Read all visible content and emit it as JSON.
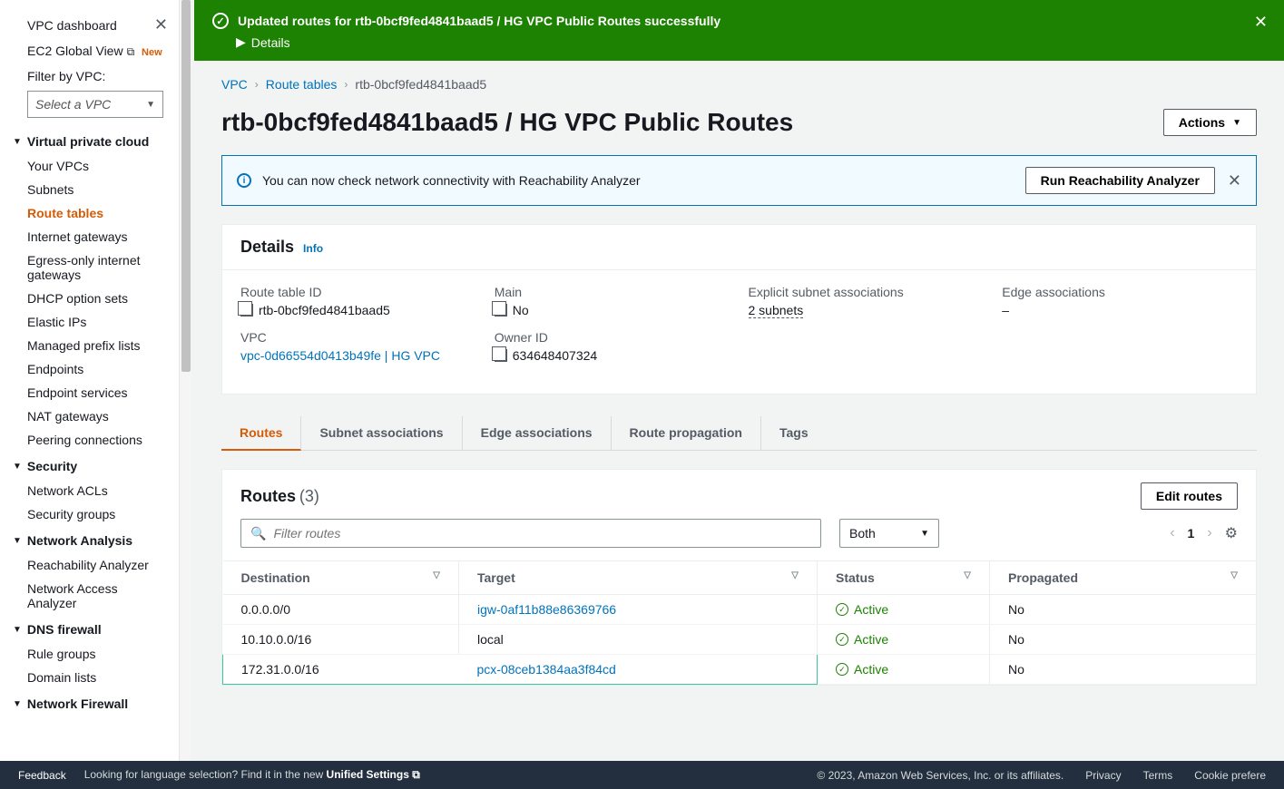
{
  "sidebar": {
    "top": {
      "dashboard": "VPC dashboard",
      "global_view": "EC2 Global View",
      "new_badge": "New",
      "filter_label": "Filter by VPC:",
      "select_placeholder": "Select a VPC"
    },
    "sections": {
      "vpc": {
        "title": "Virtual private cloud",
        "items": [
          "Your VPCs",
          "Subnets",
          "Route tables",
          "Internet gateways",
          "Egress-only internet gateways",
          "DHCP option sets",
          "Elastic IPs",
          "Managed prefix lists",
          "Endpoints",
          "Endpoint services",
          "NAT gateways",
          "Peering connections"
        ]
      },
      "security": {
        "title": "Security",
        "items": [
          "Network ACLs",
          "Security groups"
        ]
      },
      "analysis": {
        "title": "Network Analysis",
        "items": [
          "Reachability Analyzer",
          "Network Access Analyzer"
        ]
      },
      "dns": {
        "title": "DNS firewall",
        "items": [
          "Rule groups",
          "Domain lists"
        ]
      },
      "nfw": {
        "title": "Network Firewall"
      }
    }
  },
  "flash": {
    "message": "Updated routes for rtb-0bcf9fed4841baad5 / HG VPC Public Routes successfully",
    "details": "Details"
  },
  "breadcrumbs": {
    "vpc": "VPC",
    "route_tables": "Route tables",
    "current": "rtb-0bcf9fed4841baad5"
  },
  "page": {
    "title": "rtb-0bcf9fed4841baad5 / HG VPC Public Routes",
    "actions": "Actions"
  },
  "info_banner": {
    "text": "You can now check network connectivity with Reachability Analyzer",
    "button": "Run Reachability Analyzer"
  },
  "details": {
    "title": "Details",
    "info": "Info",
    "route_table_id": {
      "label": "Route table ID",
      "value": "rtb-0bcf9fed4841baad5"
    },
    "vpc": {
      "label": "VPC",
      "value": "vpc-0d66554d0413b49fe | HG VPC"
    },
    "main": {
      "label": "Main",
      "value": "No"
    },
    "owner_id": {
      "label": "Owner ID",
      "value": "634648407324"
    },
    "subnet_assoc": {
      "label": "Explicit subnet associations",
      "value": "2 subnets"
    },
    "edge_assoc": {
      "label": "Edge associations",
      "value": "–"
    }
  },
  "tabs": [
    "Routes",
    "Subnet associations",
    "Edge associations",
    "Route propagation",
    "Tags"
  ],
  "routes": {
    "title": "Routes",
    "count": "(3)",
    "edit": "Edit routes",
    "filter_placeholder": "Filter routes",
    "both": "Both",
    "page": "1",
    "headers": {
      "destination": "Destination",
      "target": "Target",
      "status": "Status",
      "propagated": "Propagated"
    },
    "rows": [
      {
        "destination": "0.0.0.0/0",
        "target": "igw-0af11b88e86369766",
        "target_link": true,
        "status": "Active",
        "propagated": "No"
      },
      {
        "destination": "10.10.0.0/16",
        "target": "local",
        "target_link": false,
        "status": "Active",
        "propagated": "No"
      },
      {
        "destination": "172.31.0.0/16",
        "target": "pcx-08ceb1384aa3f84cd",
        "target_link": true,
        "status": "Active",
        "propagated": "No"
      }
    ]
  },
  "footer": {
    "feedback": "Feedback",
    "lang_prompt": "Looking for language selection? Find it in the new ",
    "unified": "Unified Settings",
    "copyright": "© 2023, Amazon Web Services, Inc. or its affiliates.",
    "privacy": "Privacy",
    "terms": "Terms",
    "cookie": "Cookie prefere"
  }
}
